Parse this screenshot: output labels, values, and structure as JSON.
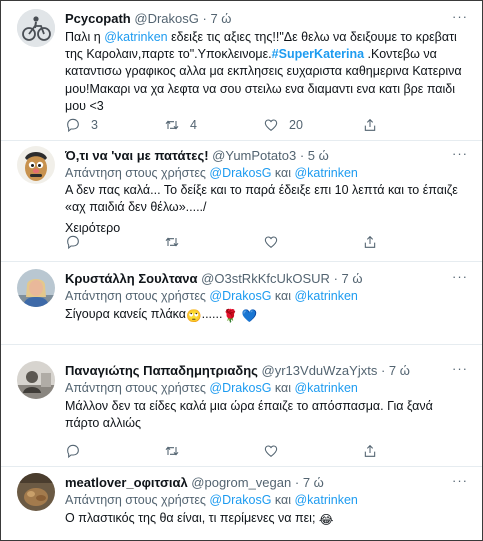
{
  "tweets": [
    {
      "author": "Pcycopath",
      "handle": "@DrakosG",
      "sep": "·",
      "time": "7 ώ",
      "body_1": "Παλι η ",
      "mention_1": "@katrinken",
      "body_2": " εδειξε τις αξιες της!!\"Δε θελω να δειξουμε το κρεβατι της Καρολαιν,παρτε το\".Υποκλεινομε.",
      "hashtag": "#SuperKaterina",
      "body_3": " .Κοντεβω να καταντισω γραφικος αλλα μα εκπλησεις ευχαριστα καθημερινα Κατερινα μου!Μακαρι να χα λεφτα να σου στειλω ενα διαμαντι ενα κατι βρε παιδι μου <3",
      "actions": {
        "reply": "3",
        "retweet": "4",
        "like": "20"
      }
    },
    {
      "author": "Ό,τι να 'ναι με πατάτες!",
      "handle": "@YumPotato3",
      "sep": "·",
      "time": "5 ώ",
      "reply_prefix": "Απάντηση στους χρήστες ",
      "reply_mention_1": "@DrakosG",
      "reply_and": " και ",
      "reply_mention_2": "@katrinken",
      "body_1": "Α δεν πας καλά... Το δείξε και το παρά έδειξε επι 10 λεπτά και το έπαιζε «αχ παιδιά δεν θέλω»...../",
      "body_2": "Χειρότερο"
    },
    {
      "author": "Κρυστάλλη Σουλτανα",
      "handle": "@O3stRkKfcUkOSUR",
      "sep": "·",
      "time": "7 ώ",
      "reply_prefix": "Απάντηση στους χρήστες ",
      "reply_mention_1": "@DrakosG",
      "reply_and": " και ",
      "reply_mention_2": "@katrinken",
      "body_1": "Σίγουρα κανείς πλάκα",
      "emoji_1": "🙄",
      "dots": "......",
      "emoji_2": "🌹",
      "emoji_3": "💙"
    },
    {
      "author": "Παναγιώτης Παπαδημητριαδης",
      "handle": "@yr13VduWzaYjxts",
      "sep": "·",
      "time": "7 ώ",
      "reply_prefix": "Απάντηση στους χρήστες ",
      "reply_mention_1": "@DrakosG",
      "reply_and": " και ",
      "reply_mention_2": "@katrinken",
      "body_1": "Μάλλον δεν τα είδες καλά μια ώρα έπαιζε το απόσπασμα. Για ξανά πάρτο αλλιώς"
    },
    {
      "author": "meatlover_οφιτσιαλ",
      "handle": "@pogrom_vegan",
      "sep": "·",
      "time": "7 ώ",
      "reply_prefix": "Απάντηση στους χρήστες ",
      "reply_mention_1": "@DrakosG",
      "reply_and": " και ",
      "reply_mention_2": "@katrinken",
      "body_1": "Ο πλαστικός της θα είναι, τι περίμενες να πει;",
      "emoji_1": "😂"
    }
  ],
  "icons": {
    "reply": "reply-icon",
    "retweet": "retweet-icon",
    "like": "heart-icon",
    "share": "share-icon",
    "more": "more-icon"
  },
  "more_glyph": "···",
  "colors": {
    "link": "#1d9bf0",
    "text": "#0f1419",
    "secondary": "#536471",
    "divider": "#e6ecf0"
  }
}
